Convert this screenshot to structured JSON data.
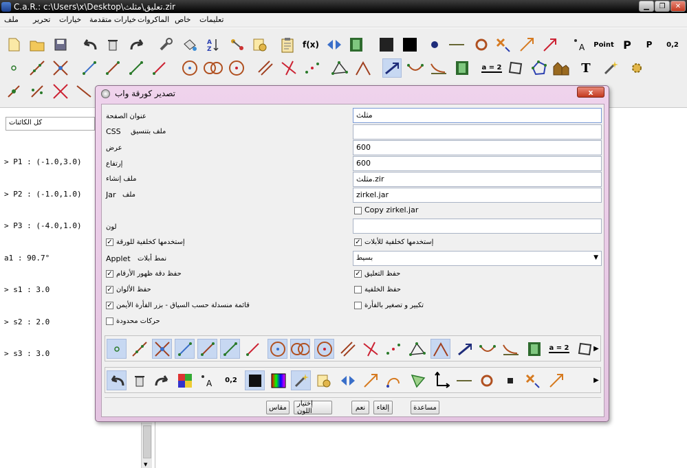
{
  "window": {
    "title": "C.a.R.: c:\\Users\\x\\Desktop\\تعليق\\مثلث.zir"
  },
  "menubar": {
    "items": [
      "ملف",
      "تحرير",
      "خيارات",
      "خيارات متقدمة",
      "الماكروات",
      "خاص",
      "تعليمات"
    ]
  },
  "toolbar_text": {
    "fx": "f(x)",
    "point_label": "Point",
    "p_big": "P",
    "p_small": "P",
    "coord": "0,2",
    "a_label": "A",
    "a_eq_2": "a = 2",
    "t_label": "T"
  },
  "left_panel": {
    "filter": "كل الكائنات",
    "objects": [
      "> P1 : (-1.0,3.0)",
      "> P2 : (-1.0,1.0)",
      "> P3 : (-4.0,1.0)",
      "a1 : 90.7°",
      "> s1 : 3.0",
      "> s2 : 2.0",
      "> s3 : 3.0"
    ]
  },
  "dialog": {
    "title": "تصدير كورقة  واب",
    "close": "x",
    "fields": {
      "page_title_label": "عنوان الصفحة",
      "page_title_value": "مثلث",
      "css_label": "ملف بتنسيق",
      "css_tag": "CSS",
      "css_value": "",
      "width_label": "عرض",
      "width_value": "600",
      "height_label": "إرتفاع",
      "height_value": "600",
      "construction_label": "ملف إنشاء",
      "construction_value": "مثلث.zir",
      "jar_label": "ملف",
      "jar_tag": "Jar",
      "jar_value": "zirkel.jar",
      "copy_zirkel": "Copy zirkel.jar",
      "color_label": "لون",
      "color_value": "",
      "bg_sheet": "إستخدمها كخلفية للورقة",
      "bg_applets": "إستخدمها كخلفية للأبلات",
      "applet_style_label": "نمط أبلات",
      "applet_tag": "Applet",
      "applet_style_value": "بسيط",
      "save_digits": "حفظ دقة ظهور الأرقام",
      "save_comment": "حفظ التعليق",
      "save_colors": "حفظ الألوان",
      "save_background": "حفظ الخلفية",
      "context_menu": "قائمة منسدلة حسب  السياق  - بزر الفأرة  الأيمن",
      "zoom_mouse": "تكبير و تصغير بالفأرة",
      "limited_moves": "حركات محدودة"
    },
    "checks": {
      "copy_zirkel": false,
      "bg_sheet": true,
      "bg_applets": true,
      "save_digits": true,
      "save_comment": true,
      "save_colors": true,
      "save_background": false,
      "context_menu": true,
      "zoom_mouse": false,
      "limited_moves": false
    },
    "row1_label": "a = 2",
    "row2_coord": "0,2",
    "row2_a": "A",
    "buttons": {
      "size": "مقاس",
      "choose_color": "إختيار اللون",
      "yes": "نعم",
      "cancel": "إلغاء",
      "help": "مساعدة"
    }
  },
  "colors": {
    "dialog_bg": "#e8c8e5",
    "selected_tool": "#c7d8f2"
  }
}
